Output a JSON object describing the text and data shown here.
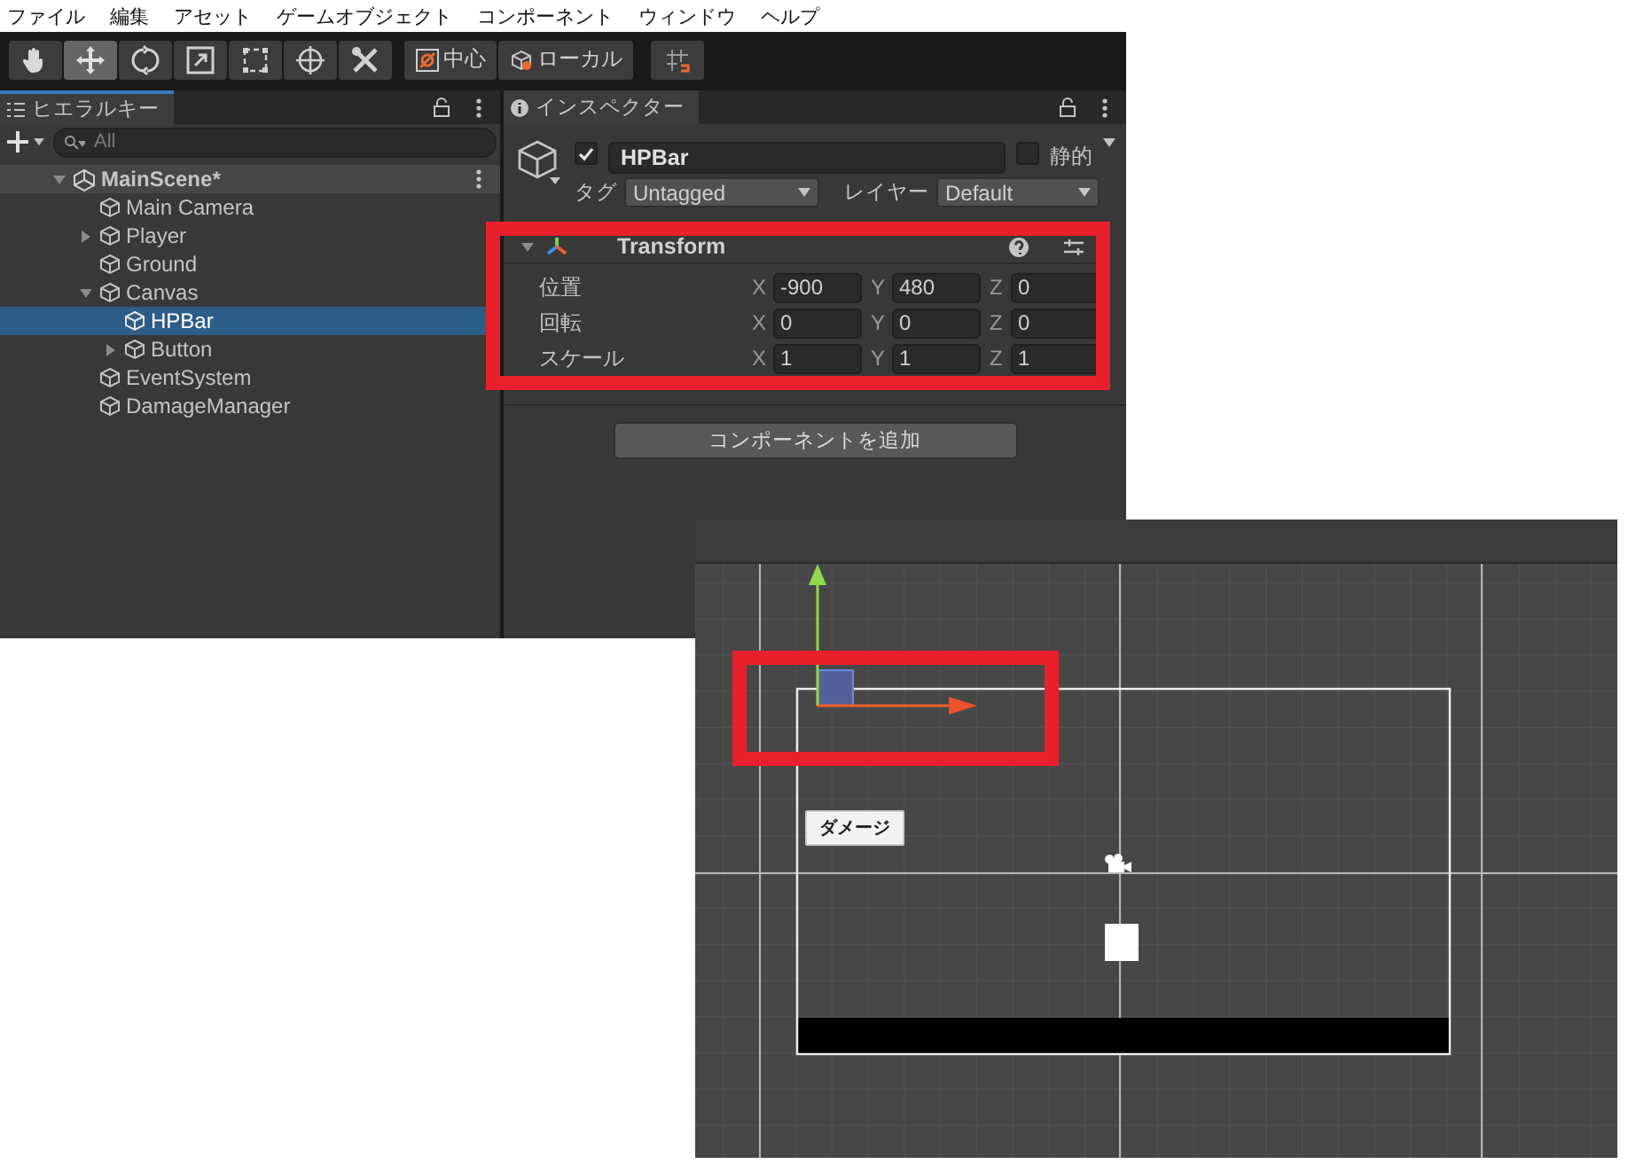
{
  "menu_bar": [
    "ファイル",
    "編集",
    "アセット",
    "ゲームオブジェクト",
    "コンポーネント",
    "ウィンドウ",
    "ヘルプ"
  ],
  "toolbar": {
    "tools": [
      {
        "kind": "hand",
        "selected": false
      },
      {
        "kind": "move",
        "selected": true
      },
      {
        "kind": "rotate",
        "selected": false
      },
      {
        "kind": "scale",
        "selected": false
      },
      {
        "kind": "rect",
        "selected": false
      },
      {
        "kind": "transform",
        "selected": false
      },
      {
        "kind": "custom",
        "selected": false
      }
    ],
    "pivot_buttons": [
      "中心",
      "ローカル"
    ]
  },
  "hierarchy": {
    "title": "ヒエラルキー",
    "search": {
      "placeholder": "All"
    },
    "scene": {
      "label": "MainScene*",
      "expanded": true,
      "children": [
        {
          "label": "Main Camera",
          "selected": false
        },
        {
          "label": "Player",
          "selected": false,
          "expanded": false
        },
        {
          "label": "Ground",
          "selected": false
        },
        {
          "label": "Canvas",
          "selected": false,
          "expanded": true,
          "children": [
            {
              "label": "HPBar",
              "selected": true
            },
            {
              "label": "Button",
              "selected": false,
              "expanded": false
            }
          ]
        },
        {
          "label": "EventSystem",
          "selected": false
        },
        {
          "label": "DamageManager",
          "selected": false
        }
      ]
    }
  },
  "inspector": {
    "title": "インスペクター",
    "object": {
      "active": true,
      "name": "HPBar",
      "static": false,
      "static_label": "静的",
      "tag_label": "タグ",
      "tag": "Untagged",
      "layer_label": "レイヤー",
      "layer": "Default"
    },
    "component": {
      "title": "Transform",
      "expanded": true,
      "rows": [
        {
          "label": "位置",
          "fields": [
            {
              "axis": "X",
              "value": "-900"
            },
            {
              "axis": "Y",
              "value": "480"
            },
            {
              "axis": "Z",
              "value": "0"
            }
          ]
        },
        {
          "label": "回転",
          "fields": [
            {
              "axis": "X",
              "value": "0"
            },
            {
              "axis": "Y",
              "value": "0"
            },
            {
              "axis": "Z",
              "value": "0"
            }
          ]
        },
        {
          "label": "スケール",
          "fields": [
            {
              "axis": "X",
              "value": "1"
            },
            {
              "axis": "Y",
              "value": "1"
            },
            {
              "axis": "Z",
              "value": "1"
            }
          ]
        }
      ]
    },
    "add_button": "コンポーネントを追加"
  },
  "scene_view": {
    "button_label": "ダメージ"
  }
}
